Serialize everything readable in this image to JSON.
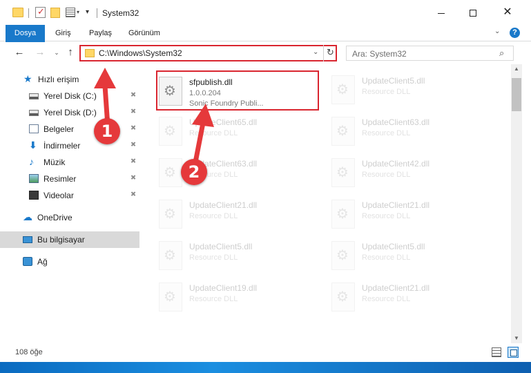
{
  "window": {
    "title": "System32",
    "minimize_icon": "minimize-icon",
    "maximize_icon": "maximize-icon",
    "close_glyph": "✕"
  },
  "ribbon": {
    "tabs": [
      "Dosya",
      "Giriş",
      "Paylaş",
      "Görünüm"
    ],
    "help_glyph": "?",
    "collapse_glyph": "⌄"
  },
  "address": {
    "path": "C:\\Windows\\System32",
    "dropdown_glyph": "⌄",
    "refresh_glyph": "↻"
  },
  "search": {
    "placeholder": "Ara: System32",
    "icon_glyph": "⌕"
  },
  "nav": {
    "back_glyph": "←",
    "forward_glyph": "→",
    "history_glyph": "⌄",
    "up_glyph": "↑"
  },
  "sidebar": {
    "items": [
      {
        "label": "Hızlı erişim",
        "icon": "star-icon",
        "pinned": false
      },
      {
        "label": "Yerel Disk (C:)",
        "icon": "disk-icon",
        "pinned": true
      },
      {
        "label": "Yerel Disk (D:)",
        "icon": "disk-icon",
        "pinned": true
      },
      {
        "label": "Belgeler",
        "icon": "documents-icon",
        "pinned": true
      },
      {
        "label": "İndirmeler",
        "icon": "download-icon",
        "pinned": true
      },
      {
        "label": "Müzik",
        "icon": "music-icon",
        "pinned": true
      },
      {
        "label": "Resimler",
        "icon": "pictures-icon",
        "pinned": true
      },
      {
        "label": "Videolar",
        "icon": "videos-icon",
        "pinned": true
      },
      {
        "label": "OneDrive",
        "icon": "onedrive-icon",
        "pinned": false
      },
      {
        "label": "Bu bilgisayar",
        "icon": "this-pc-icon",
        "pinned": false,
        "selected": true
      },
      {
        "label": "Ağ",
        "icon": "network-icon",
        "pinned": false
      }
    ],
    "pin_glyph": "📌"
  },
  "files": [
    {
      "name": "sfpublish.dll",
      "line2": "1.0.0.204",
      "line3": "Sonic Foundry Publi...",
      "highlighted": true
    },
    {
      "name": "UpdateClient5.dll",
      "line2": "Resource DLL",
      "faded": true
    },
    {
      "name": "UpdateClient65.dll",
      "line2": "Resource DLL",
      "faded": true
    },
    {
      "name": "UpdateClient63.dll",
      "line2": "Resource DLL",
      "faded": true
    },
    {
      "name": "UpdateClient63.dll",
      "line2": "Resource DLL",
      "faded": true
    },
    {
      "name": "UpdateClient42.dll",
      "line2": "Resource DLL",
      "faded": true
    },
    {
      "name": "UpdateClient21.dll",
      "line2": "Resource DLL",
      "faded": true
    },
    {
      "name": "UpdateClient21.dll",
      "line2": "Resource DLL",
      "faded": true
    },
    {
      "name": "UpdateClient5.dll",
      "line2": "Resource DLL",
      "faded": true
    },
    {
      "name": "UpdateClient5.dll",
      "line2": "Resource DLL",
      "faded": true
    },
    {
      "name": "UpdateClient19.dll",
      "line2": "Resource DLL",
      "faded": true
    },
    {
      "name": "UpdateClient21.dll",
      "line2": "Resource DLL",
      "faded": true
    }
  ],
  "status": {
    "item_count": "108 öğe"
  },
  "annotations": {
    "badge1": "1",
    "badge2": "2",
    "color": "#e5393b"
  },
  "colors": {
    "accent": "#1979ca",
    "highlight_border": "#d9252f"
  }
}
